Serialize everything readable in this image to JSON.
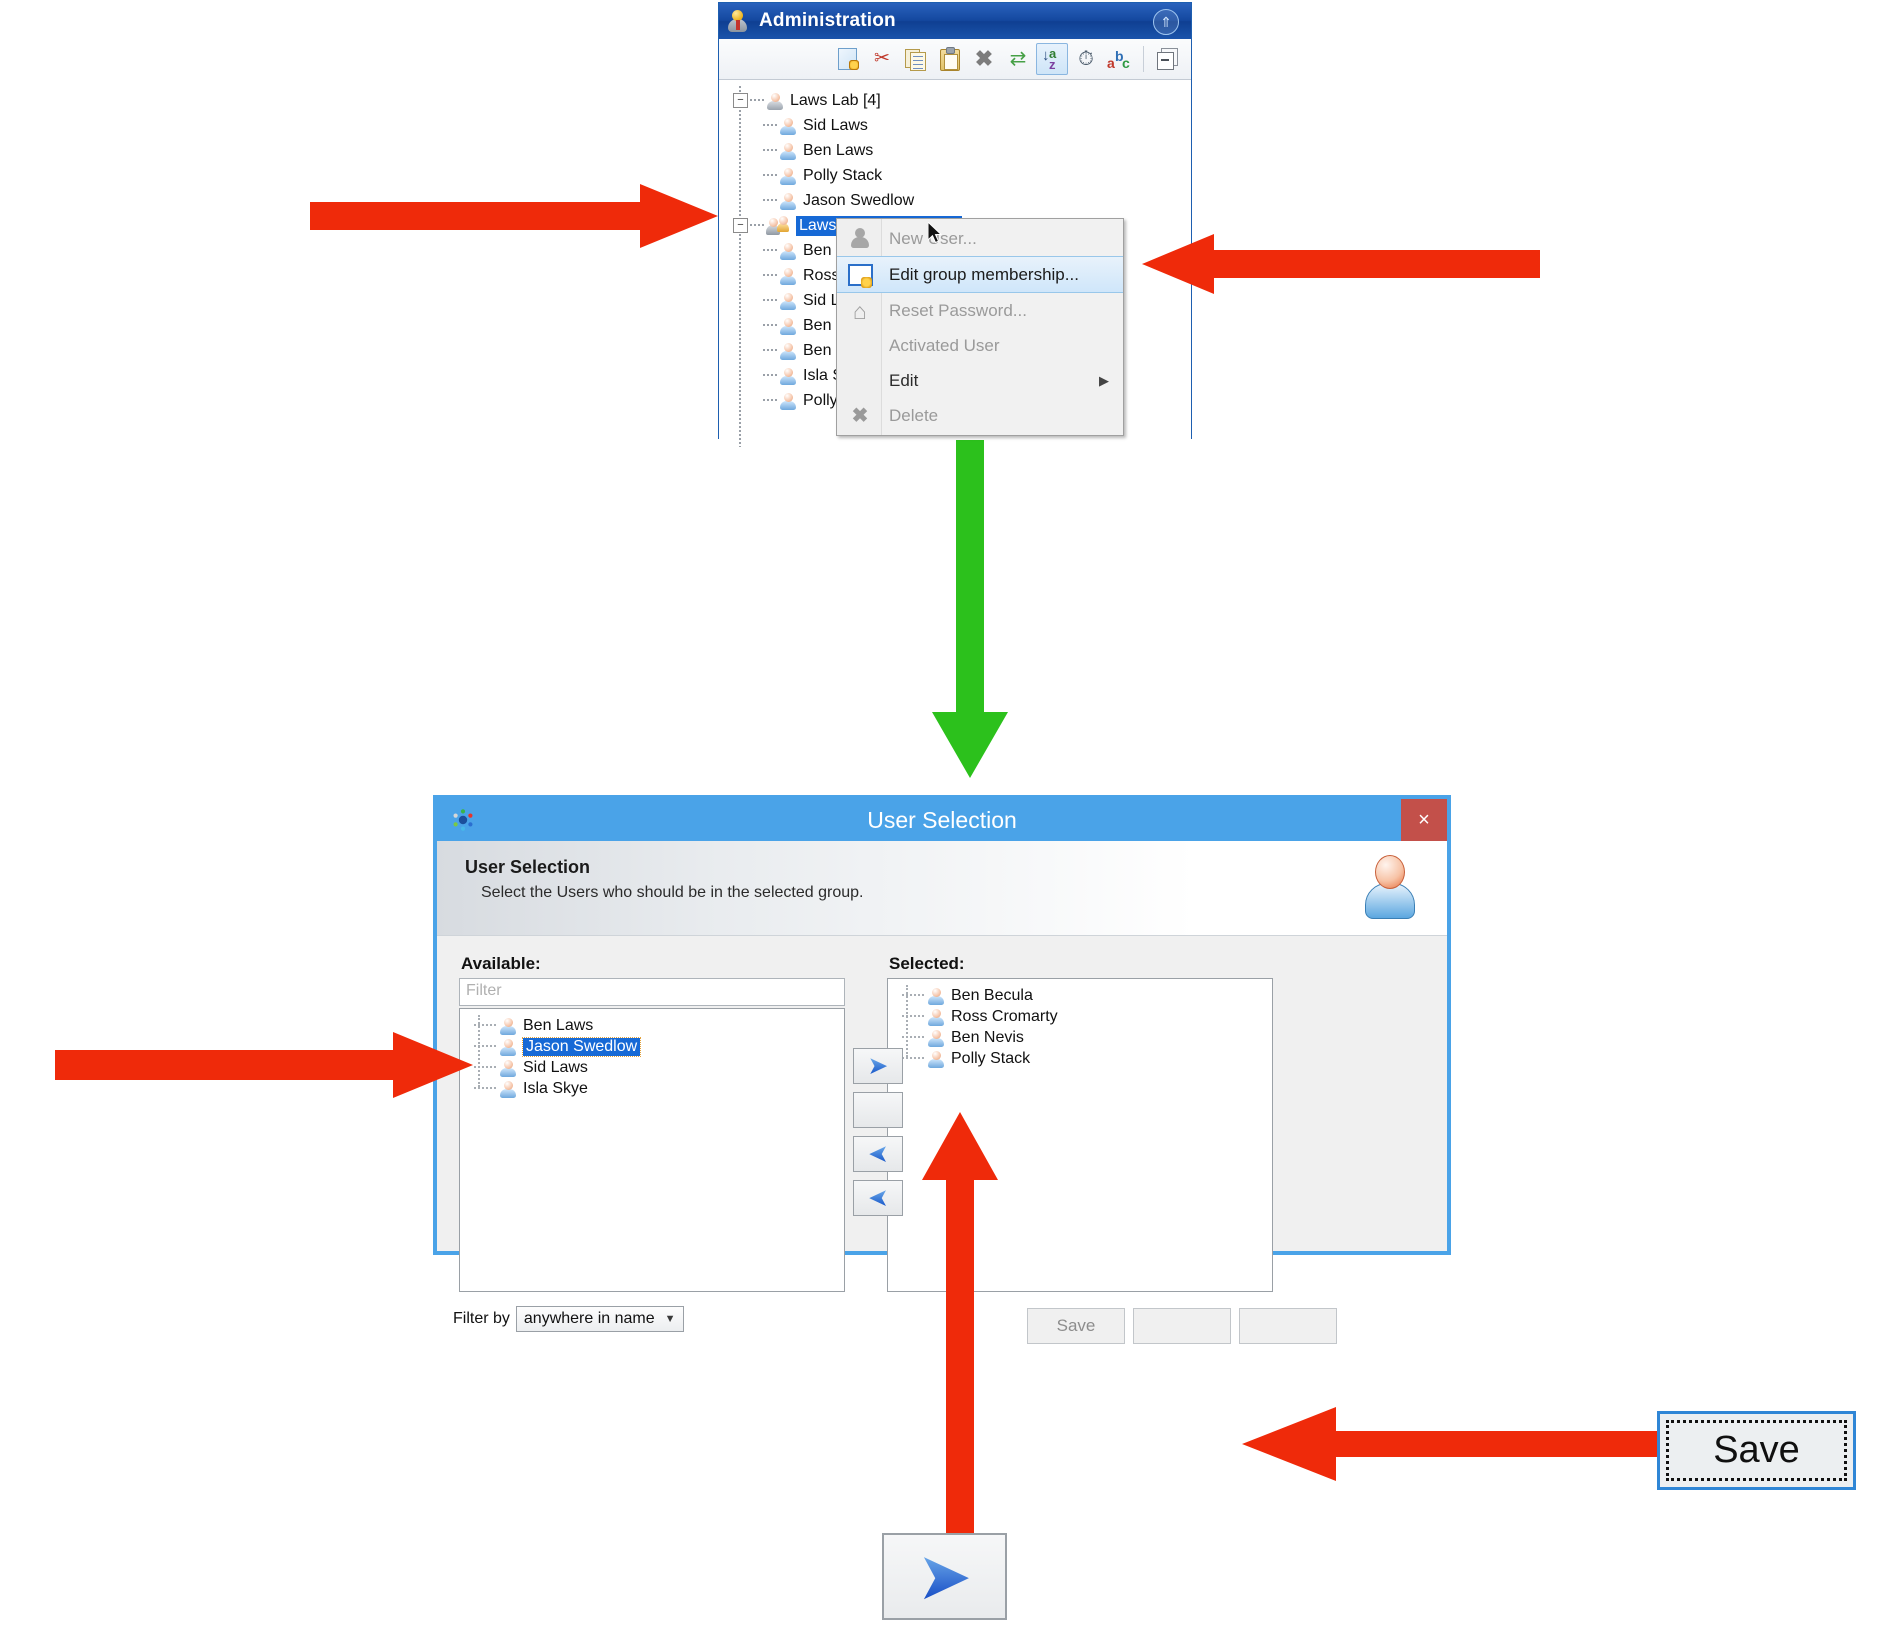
{
  "admin_window": {
    "title": "Administration",
    "collapse_icon": "chevron-double-up-icon",
    "toolbar": [
      {
        "name": "new-item-button",
        "icon": "new-document-icon",
        "active": false
      },
      {
        "name": "cut-button",
        "icon": "scissors-icon",
        "active": false
      },
      {
        "name": "copy-button",
        "icon": "copy-icon",
        "active": false
      },
      {
        "name": "paste-button",
        "icon": "paste-icon",
        "active": false
      },
      {
        "name": "delete-button",
        "icon": "cross-icon",
        "active": false
      },
      {
        "name": "refresh-button",
        "icon": "refresh-icon",
        "active": false
      },
      {
        "name": "sort-az-button",
        "icon": "sort-a-z-icon",
        "active": true
      },
      {
        "name": "history-button",
        "icon": "stopwatch-icon",
        "active": false
      },
      {
        "name": "spelling-button",
        "icon": "abc-letters-icon",
        "active": false
      },
      {
        "name": "collapse-all-button",
        "icon": "collapse-tree-icon",
        "active": false
      }
    ],
    "tree": [
      {
        "label": "Laws Lab [4]",
        "level": 0,
        "type": "group",
        "expander": "minus",
        "selected": false
      },
      {
        "label": "Sid Laws",
        "level": 1,
        "type": "user",
        "selected": false
      },
      {
        "label": "Ben Laws",
        "level": 1,
        "type": "user",
        "selected": false
      },
      {
        "label": "Polly Stack",
        "level": 1,
        "type": "user",
        "selected": false
      },
      {
        "label": "Jason Swedlow",
        "level": 1,
        "type": "user",
        "selected": false
      },
      {
        "label": "Laws-Swedlow Lab [7]",
        "level": 0,
        "type": "group",
        "expander": "minus",
        "selected": true
      },
      {
        "label": "Ben Becula",
        "level": 1,
        "type": "user",
        "selected": false
      },
      {
        "label": "Ross Cromarty",
        "level": 1,
        "type": "user",
        "selected": false
      },
      {
        "label": "Sid Laws",
        "level": 1,
        "type": "user",
        "selected": false
      },
      {
        "label": "Ben Laws",
        "level": 1,
        "type": "user",
        "selected": false
      },
      {
        "label": "Ben Nevis",
        "level": 1,
        "type": "user",
        "selected": false
      },
      {
        "label": "Isla Skye",
        "level": 1,
        "type": "user",
        "selected": false
      },
      {
        "label": "Polly Stack",
        "level": 1,
        "type": "user",
        "selected": false
      }
    ]
  },
  "context_menu": {
    "items": [
      {
        "label": "New User...",
        "icon": "user-icon",
        "state": "disabled",
        "submenu": false
      },
      {
        "label": "Edit group membership...",
        "icon": "edit-group-icon",
        "state": "highlight",
        "submenu": false
      },
      {
        "label": "Reset Password...",
        "icon": "home-icon",
        "state": "disabled",
        "submenu": false
      },
      {
        "label": "Activated User",
        "icon": "none",
        "state": "disabled",
        "submenu": false
      },
      {
        "label": "Edit",
        "icon": "none",
        "state": "enabled",
        "submenu": true
      },
      {
        "label": "Delete",
        "icon": "cross-icon",
        "state": "disabled",
        "submenu": false
      }
    ],
    "submenu_arrow": "▶"
  },
  "user_selection_dialog": {
    "window_title": "User Selection",
    "app_icon": "omero-dots-icon",
    "close_label": "×",
    "header_title": "User Selection",
    "header_subtitle": "Select the Users who should be in the selected group.",
    "header_avatar_icon": "user-avatar-icon",
    "available_label": "Available:",
    "selected_label": "Selected:",
    "filter_placeholder": "Filter",
    "filter_value": "",
    "available_users": [
      {
        "label": "Ben Laws",
        "selected": false
      },
      {
        "label": "Jason Swedlow",
        "selected": true
      },
      {
        "label": "Sid Laws",
        "selected": false
      },
      {
        "label": "Isla Skye",
        "selected": false
      }
    ],
    "selected_users": [
      {
        "label": "Ben Becula",
        "selected": false
      },
      {
        "label": "Ross Cromarty",
        "selected": false
      },
      {
        "label": "Ben Nevis",
        "selected": false
      },
      {
        "label": "Polly Stack",
        "selected": false
      }
    ],
    "transfer_buttons": [
      {
        "name": "move-right-one-button",
        "glyph": "➤",
        "icon": "chevron-right-icon"
      },
      {
        "name": "move-right-all-button",
        "glyph": "➤➤",
        "icon": "double-chevron-right-icon"
      },
      {
        "name": "move-left-one-button",
        "glyph": "➤",
        "icon": "chevron-left-icon"
      },
      {
        "name": "move-left-all-button",
        "glyph": "➤➤",
        "icon": "double-chevron-left-icon"
      }
    ],
    "filter_by_label": "Filter by",
    "filter_by_value": "anywhere in name",
    "filter_by_caret": "▼",
    "buttons": [
      {
        "name": "save-button",
        "label": "Save"
      },
      {
        "name": "secondary-button-2",
        "label": ""
      },
      {
        "name": "secondary-button-3",
        "label": ""
      }
    ]
  },
  "annotations": {
    "save_callout_label": "Save",
    "chevron_callout_icon": "chevron-right-icon",
    "arrow_color": "#ef2a0a",
    "flow_arrow_color": "#2cc11c",
    "arrows": [
      {
        "name": "arrow-to-group-node",
        "color": "#ef2a0a"
      },
      {
        "name": "arrow-to-edit-group-membership",
        "color": "#ef2a0a"
      },
      {
        "name": "arrow-flow-down",
        "color": "#2cc11c"
      },
      {
        "name": "arrow-to-available-user",
        "color": "#ef2a0a"
      },
      {
        "name": "arrow-to-transfer-button",
        "color": "#ef2a0a"
      },
      {
        "name": "arrow-to-save-button",
        "color": "#ef2a0a"
      }
    ]
  },
  "colors": {
    "title_blue": "#14489f",
    "dialog_blue": "#4aa3e8",
    "selection_blue": "#1669d6",
    "close_red": "#c3504a"
  }
}
